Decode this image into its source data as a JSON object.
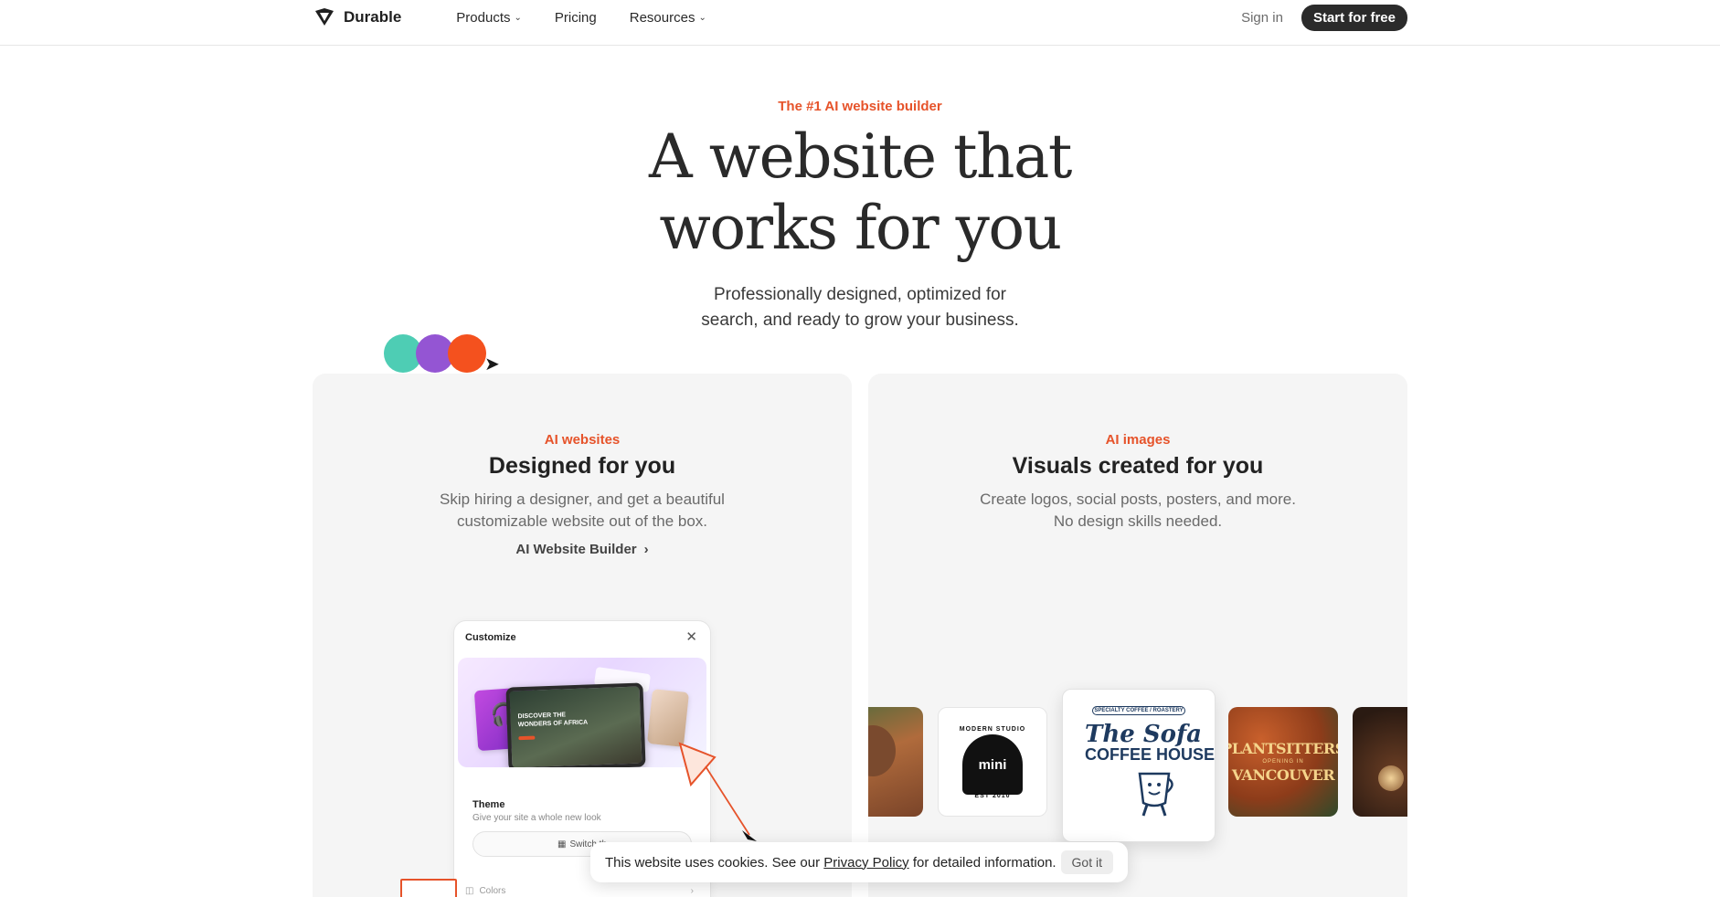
{
  "nav": {
    "brand": "Durable",
    "links": [
      {
        "label": "Products",
        "has_menu": true
      },
      {
        "label": "Pricing",
        "has_menu": false
      },
      {
        "label": "Resources",
        "has_menu": true
      }
    ],
    "sign_in": "Sign in",
    "cta": "Start for free"
  },
  "hero": {
    "eyebrow": "The #1 AI website builder",
    "headline_line1": "A website that",
    "headline_line2": "works for you",
    "sub_line1": "Professionally designed, optimized for",
    "sub_line2": "search, and ready to grow your business."
  },
  "colors": {
    "accent": "#e6532a",
    "dot_teal": "#4ecdb4",
    "dot_purple": "#9455d3",
    "dot_orange": "#f4511e"
  },
  "cards": {
    "websites": {
      "eyebrow": "AI websites",
      "title": "Designed for you",
      "desc_line1": "Skip hiring a designer, and get a beautiful",
      "desc_line2": "customizable website out of the box.",
      "link": "AI Website Builder",
      "panel": {
        "title": "Customize",
        "preview_text_line1": "DISCOVER THE",
        "preview_text_line2": "WONDERS OF AFRICA",
        "theme_label": "Theme",
        "theme_desc": "Give your site a whole new look",
        "switch_label": "Switch th",
        "colors_label": "Colors"
      }
    },
    "images": {
      "eyebrow": "AI images",
      "title": "Visuals created for you",
      "desc_line1": "Create logos, social posts, posters, and more.",
      "desc_line2": "No design skills needed.",
      "tiles": {
        "mini_top": "MODERN STUDIO",
        "mini_center": "mini",
        "mini_bottom": "EST 2010",
        "sofa_tag": "SPECIALTY COFFEE / ROASTERY",
        "sofa_title": "The Sofa",
        "sofa_sub": "COFFEE HOUSE",
        "plant_a": "PLANTSITTERS",
        "plant_b": "OPENING IN",
        "plant_c": "VANCOUVER"
      }
    }
  },
  "cookie": {
    "text_before": "This website uses cookies. See our ",
    "link": "Privacy Policy",
    "text_after": " for detailed information.",
    "button": "Got it"
  }
}
